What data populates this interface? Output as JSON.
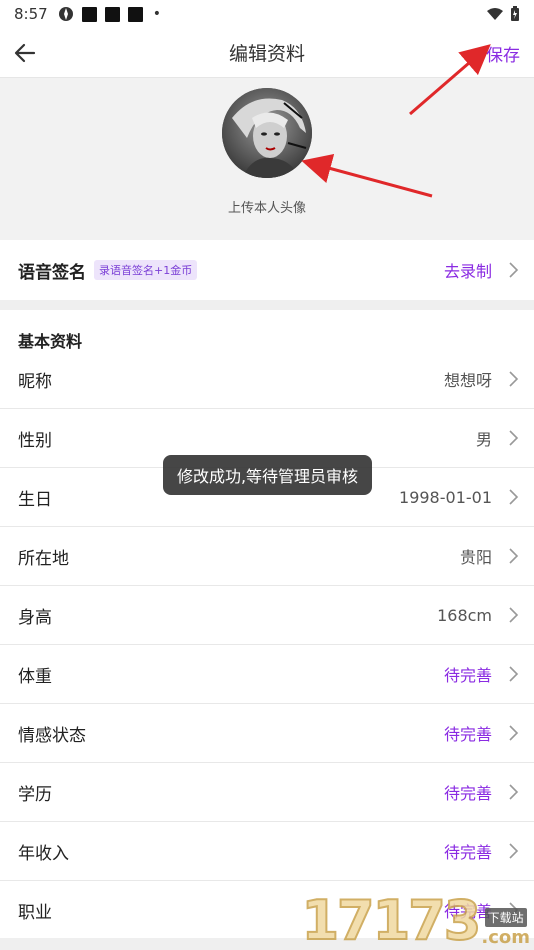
{
  "status_bar": {
    "time": "8:57"
  },
  "nav": {
    "title": "编辑资料",
    "save_label": "保存"
  },
  "avatar": {
    "hint": "上传本人头像"
  },
  "voice": {
    "label": "语音签名",
    "tag": "录语音签名+1金币",
    "action": "去录制"
  },
  "basic_section": {
    "title": "基本资料"
  },
  "rows": [
    {
      "label": "昵称",
      "value": "想想呀",
      "pending": false
    },
    {
      "label": "性别",
      "value": "男",
      "pending": false
    },
    {
      "label": "生日",
      "value": "1998-01-01",
      "pending": false
    },
    {
      "label": "所在地",
      "value": "贵阳",
      "pending": false
    },
    {
      "label": "身高",
      "value": "168cm",
      "pending": false
    },
    {
      "label": "体重",
      "value": "待完善",
      "pending": true
    },
    {
      "label": "情感状态",
      "value": "待完善",
      "pending": true
    },
    {
      "label": "学历",
      "value": "待完善",
      "pending": true
    },
    {
      "label": "年收入",
      "value": "待完善",
      "pending": true
    },
    {
      "label": "职业",
      "value": "待完善",
      "pending": true
    }
  ],
  "toast": {
    "text": "修改成功,等待管理员审核"
  },
  "watermark": {
    "number": "17173",
    "cn": "下载站",
    "com": ".com"
  },
  "colors": {
    "accent": "#8a2be2",
    "arrow": "#e0282a",
    "page_bg": "#f2f2f2"
  }
}
